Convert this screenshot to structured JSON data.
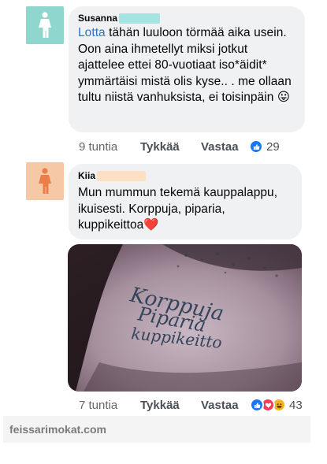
{
  "comments": [
    {
      "author": "Susanna",
      "mention": "Lotta",
      "text": " tähän luuloon törmää aika usein. Oon aina ihmetellyt miksi jotkut ajattelee ettei 80-vuotiaat iso*äidit* ymmärtäisi mistä olis kyse.. . me ollaan tultu niistä vanhuksista, ei toisinpäin 😛",
      "time": "9 tuntia",
      "like_label": "Tykkää",
      "reply_label": "Vastaa",
      "reaction_count": "29",
      "reactions": [
        "like-icon"
      ],
      "avatar_color": "#8fd6cf",
      "redact_color": "#a5e4e2"
    },
    {
      "author": "Kiia",
      "text": "Mun mummun tekemä kauppalappu, ikuisesti. Korppuja, piparia, kuppikeittoa❤️",
      "time": "7 tuntia",
      "like_label": "Tykkää",
      "reply_label": "Vastaa",
      "reaction_count": "43",
      "reactions": [
        "like-icon",
        "love-icon",
        "haha-icon"
      ],
      "avatar_color": "#f6c8a6",
      "redact_color": "#fde0c4",
      "photo_text": [
        "Korppuja",
        "Piparia",
        "kuppikeitto"
      ]
    }
  ],
  "footer": {
    "watermark": "feissarimokat.com"
  },
  "colors": {
    "bubble": "#eff1f3",
    "mention": "#2d73c4",
    "like_blue": "#1877f2",
    "love_red": "#f33e58",
    "haha_yellow": "#f7b125"
  }
}
